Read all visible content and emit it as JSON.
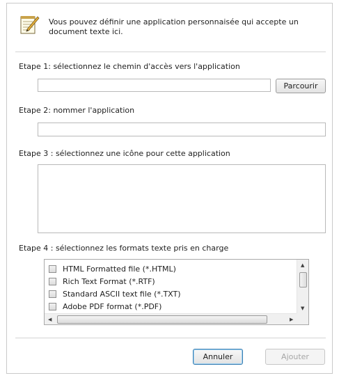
{
  "header": {
    "icon": "notepad-pen-icon",
    "text": "Vous pouvez définir une application personnaisée qui accepte un document texte ici."
  },
  "step1": {
    "label": "Etape 1: sélectionnez le chemin d'accès vers l'application",
    "path_value": "",
    "browse_label": "Parcourir"
  },
  "step2": {
    "label": "Etape 2: nommer l'application",
    "name_value": ""
  },
  "step3": {
    "label": "Etape 3 : sélectionnez une icône pour cette application"
  },
  "step4": {
    "label": "Etape 4 : sélectionnez les formats texte pris en charge",
    "formats": [
      {
        "label": "HTML Formatted file (*.HTML)",
        "checked": false
      },
      {
        "label": "Rich Text Format (*.RTF)",
        "checked": false
      },
      {
        "label": "Standard ASCII text file (*.TXT)",
        "checked": false
      },
      {
        "label": "Adobe PDF format (*.PDF)",
        "checked": false
      }
    ]
  },
  "buttons": {
    "cancel_label": "Annuler",
    "add_label": "Ajouter"
  },
  "colors": {
    "border": "#c9c9c9",
    "primary_button_border": "#3c7fb1",
    "disabled_text": "#a6a6a6"
  }
}
